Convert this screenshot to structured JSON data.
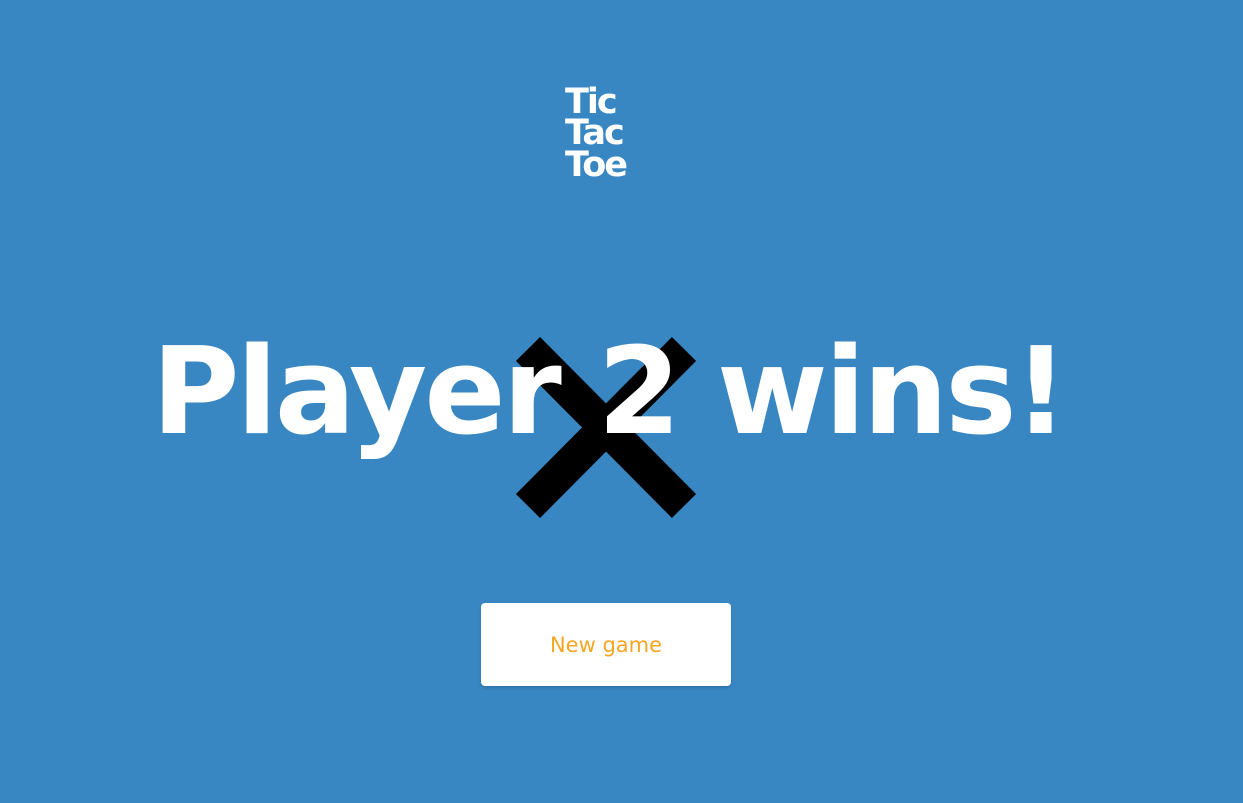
{
  "logo": {
    "line1": "Tic",
    "line2": "Tac",
    "line3": "Toe"
  },
  "result": {
    "headline": "Player 2 wins!",
    "winner_mark": "x-mark-icon"
  },
  "actions": {
    "new_game_label": "New game"
  },
  "colors": {
    "background": "#3887c3",
    "headline_text": "#ffffff",
    "mark": "#000000",
    "button_background": "#ffffff",
    "button_text": "#f5a623"
  }
}
